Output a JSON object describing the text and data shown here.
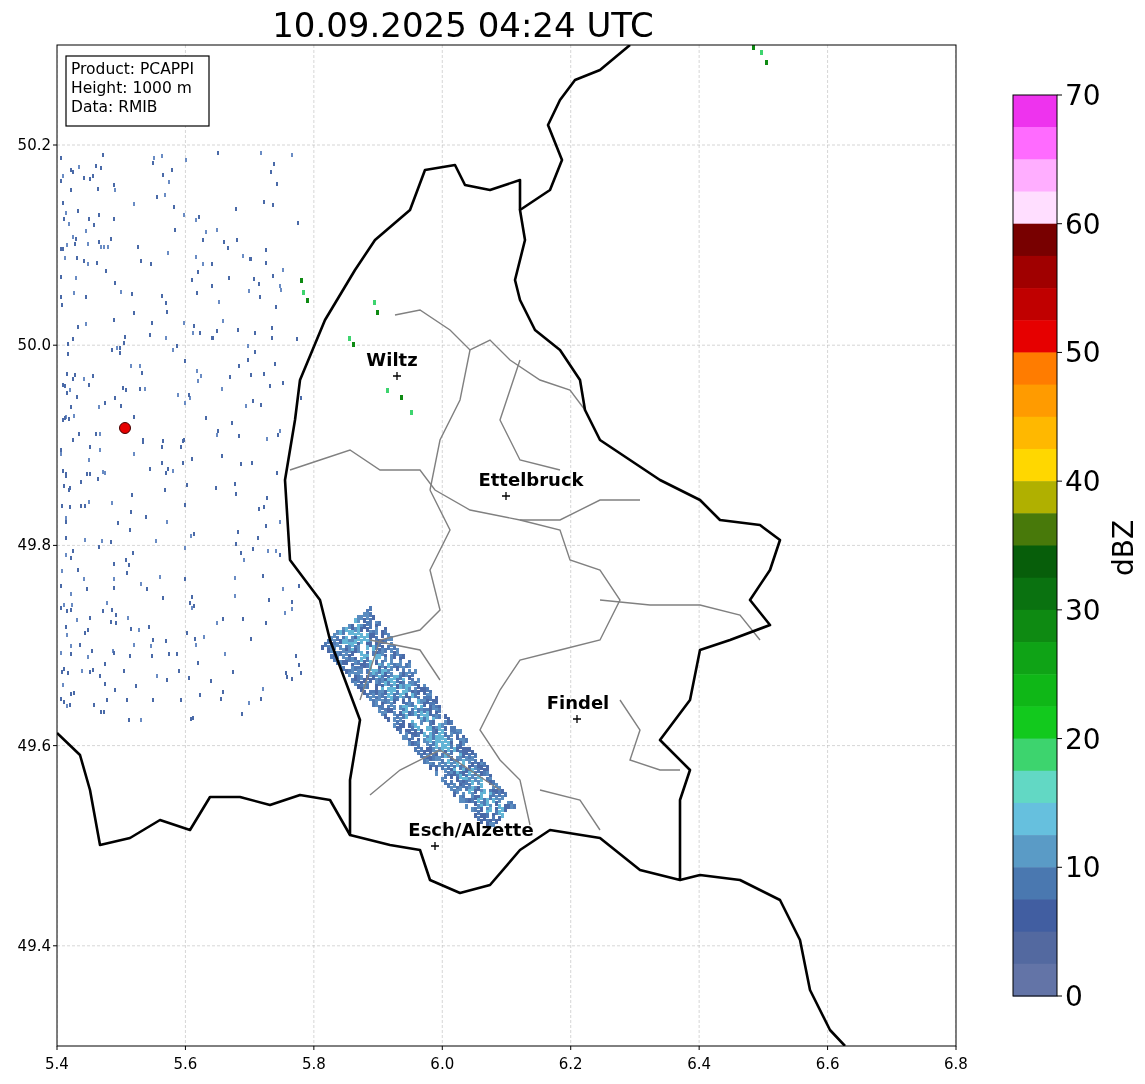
{
  "title": "10.09.2025 04:24 UTC",
  "info_box": [
    "Product: PCAPPI",
    "Height: 1000 m",
    "Data: RMIB"
  ],
  "cities": [
    {
      "name": "Wiltz"
    },
    {
      "name": "Ettelbruck"
    },
    {
      "name": "Findel"
    },
    {
      "name": "Esch/Alzette"
    }
  ],
  "x_ticks": [
    "5.4",
    "5.6",
    "5.8",
    "6.0",
    "6.2",
    "6.4",
    "6.6",
    "6.8"
  ],
  "y_ticks": [
    "50.2",
    "50.0",
    "49.8",
    "49.6",
    "49.4"
  ],
  "colorbar": {
    "label": "dBZ",
    "ticks": [
      "70",
      "60",
      "50",
      "40",
      "30",
      "20",
      "10",
      "0"
    ],
    "bins": [
      {
        "color": "#ee33ee"
      },
      {
        "color": "#ff6bff"
      },
      {
        "color": "#ffaeff"
      },
      {
        "color": "#ffdeff"
      },
      {
        "color": "#780000"
      },
      {
        "color": "#a00000"
      },
      {
        "color": "#c00000"
      },
      {
        "color": "#e60000"
      },
      {
        "color": "#ff7c00"
      },
      {
        "color": "#ff9b00"
      },
      {
        "color": "#ffb800"
      },
      {
        "color": "#ffd700"
      },
      {
        "color": "#b0b000"
      },
      {
        "color": "#48790a"
      },
      {
        "color": "#075e0a"
      },
      {
        "color": "#0a7210"
      },
      {
        "color": "#0e8a12"
      },
      {
        "color": "#0fa316"
      },
      {
        "color": "#0fb717"
      },
      {
        "color": "#12c91d"
      },
      {
        "color": "#3dd46e"
      },
      {
        "color": "#62d8c4"
      },
      {
        "color": "#66c0de"
      },
      {
        "color": "#5a9bc6"
      },
      {
        "color": "#4a78b0"
      },
      {
        "color": "#415ea1"
      },
      {
        "color": "#5369a0"
      },
      {
        "color": "#6374a7"
      }
    ]
  }
}
